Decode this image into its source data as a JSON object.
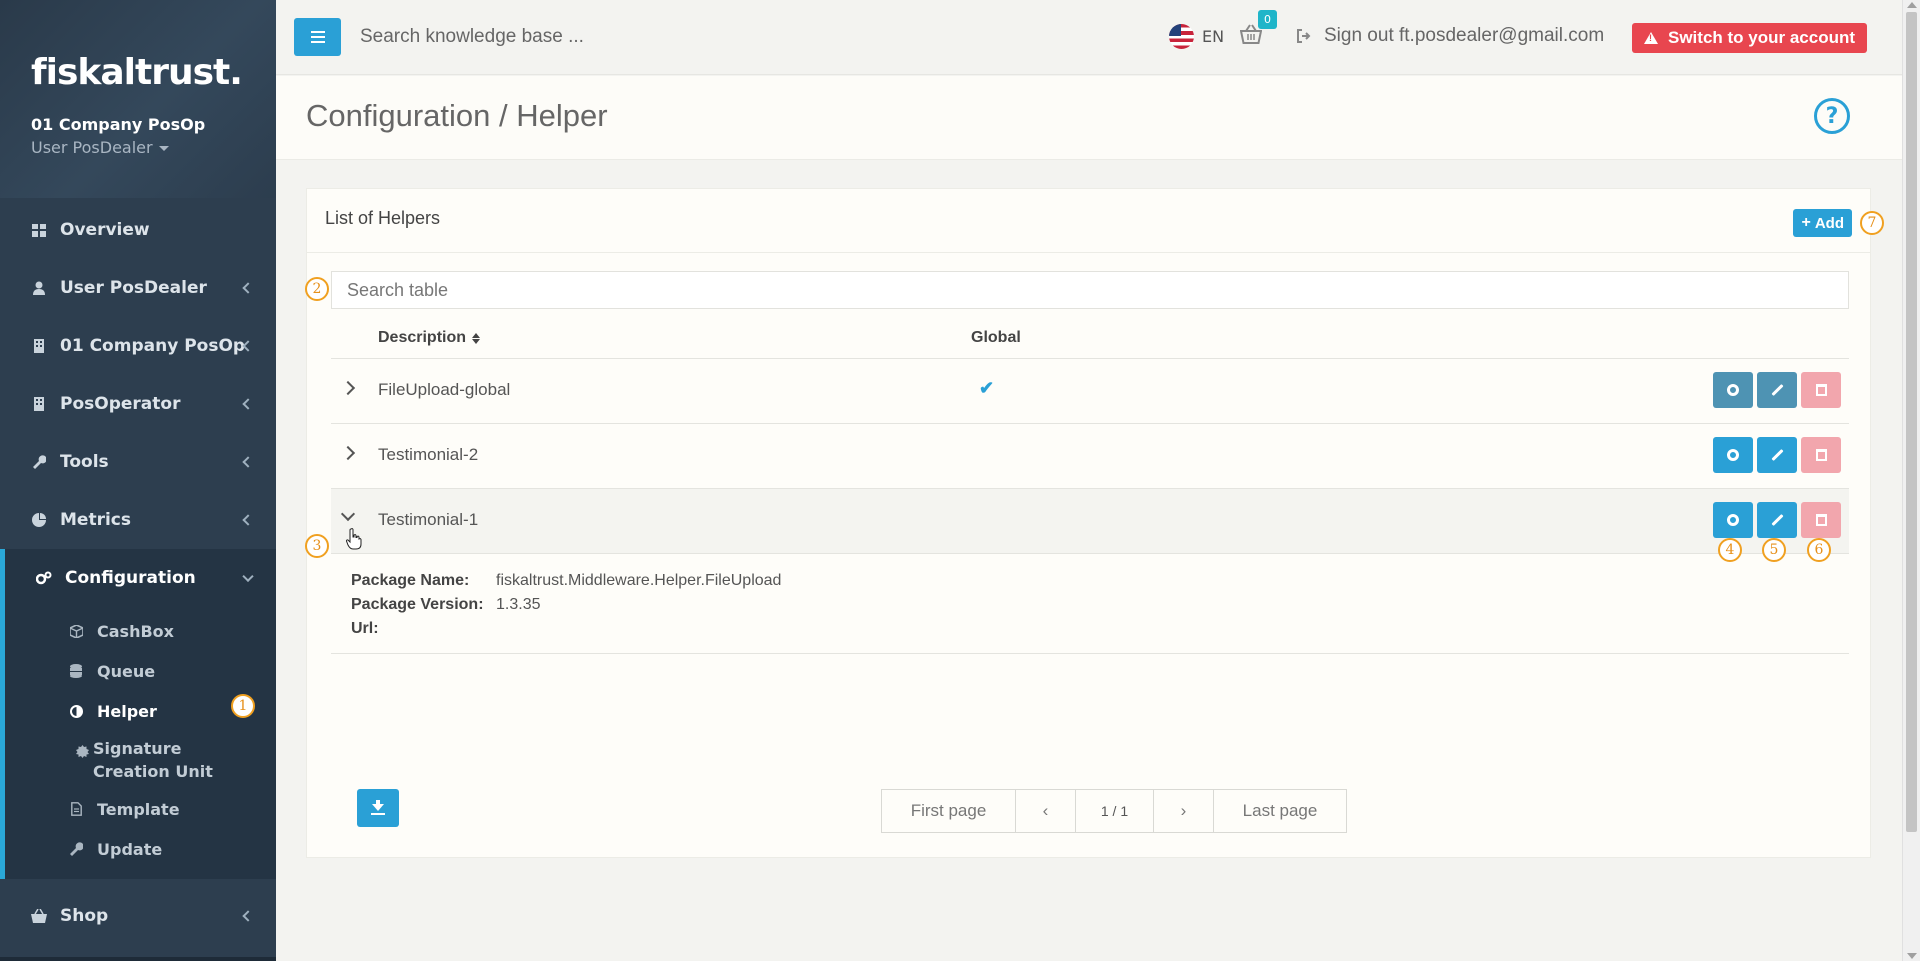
{
  "sidebar": {
    "logo": "fiskaltrust.",
    "company": "01 Company PosOp",
    "user": "User PosDealer",
    "items": [
      {
        "label": "Overview",
        "icon": "dashboard-icon"
      },
      {
        "label": "User PosDealer",
        "icon": "user-icon"
      },
      {
        "label": "01 Company PosOp",
        "icon": "building-icon"
      },
      {
        "label": "PosOperator",
        "icon": "building-icon"
      },
      {
        "label": "Tools",
        "icon": "wrench-icon"
      },
      {
        "label": "Metrics",
        "icon": "pie-chart-icon"
      },
      {
        "label": "Configuration",
        "icon": "gears-icon"
      },
      {
        "label": "Shop",
        "icon": "basket-icon"
      }
    ],
    "config_sub": [
      {
        "label": "CashBox",
        "icon": "cube-icon"
      },
      {
        "label": "Queue",
        "icon": "database-icon"
      },
      {
        "label": "Helper",
        "icon": "half-circle-icon"
      },
      {
        "label": "Signature Creation Unit",
        "icon": "certificate-icon"
      },
      {
        "label": "Template",
        "icon": "file-icon"
      },
      {
        "label": "Update",
        "icon": "wrench-icon"
      }
    ]
  },
  "topbar": {
    "search_placeholder": "Search knowledge base ...",
    "lang": "EN",
    "cart_count": "0",
    "signout": "Sign out ft.posdealer@gmail.com",
    "switch_label": "Switch to your account"
  },
  "page": {
    "title": "Configuration / Helper",
    "help": "?"
  },
  "card": {
    "title": "List of Helpers",
    "add_label": "Add",
    "search_placeholder": "Search table",
    "columns": {
      "description": "Description",
      "global": "Global"
    },
    "rows": [
      {
        "description": "FileUpload-global",
        "global": true
      },
      {
        "description": "Testimonial-2",
        "global": false
      },
      {
        "description": "Testimonial-1",
        "global": false
      }
    ],
    "details": {
      "package_name_label": "Package Name:",
      "package_name": "fiskaltrust.Middleware.Helper.FileUpload",
      "package_version_label": "Package Version:",
      "package_version": "1.3.35",
      "url_label": "Url:",
      "url": ""
    },
    "pager": {
      "first": "First page",
      "prev": "‹",
      "info": "1 / 1",
      "next": "›",
      "last": "Last page"
    }
  },
  "markers": [
    "1",
    "2",
    "3",
    "4",
    "5",
    "6",
    "7"
  ],
  "colors": {
    "sidebar_bg": "#2d3e4f",
    "accent": "#2aa0d6",
    "danger": "#e8464f",
    "delete_btn": "#f2a6ad",
    "marker": "#f0a020"
  }
}
